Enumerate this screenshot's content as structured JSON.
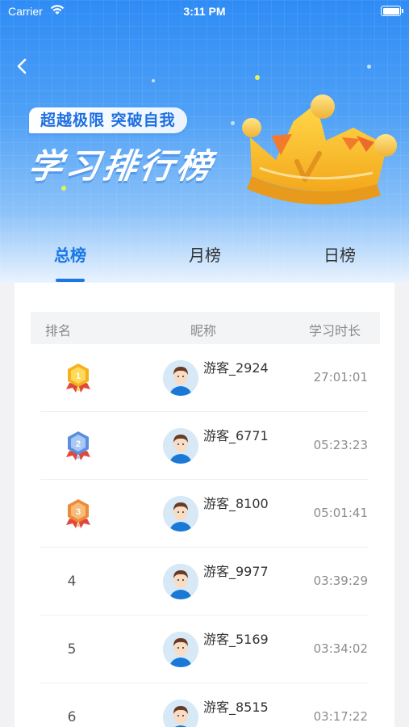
{
  "status_bar": {
    "carrier": "Carrier",
    "time": "3:11 PM"
  },
  "header": {
    "slogan": "超越极限  突破自我",
    "title": "学习排行榜"
  },
  "tabs": [
    {
      "label": "总榜",
      "active": true
    },
    {
      "label": "月榜",
      "active": false
    },
    {
      "label": "日榜",
      "active": false
    }
  ],
  "table": {
    "headers": {
      "rank": "排名",
      "nickname": "昵称",
      "duration": "学习时长"
    },
    "rows": [
      {
        "rank": "1",
        "medal": "gold",
        "nickname": "游客_2924",
        "duration": "27:01:01"
      },
      {
        "rank": "2",
        "medal": "silver",
        "nickname": "游客_6771",
        "duration": "05:23:23"
      },
      {
        "rank": "3",
        "medal": "bronze",
        "nickname": "游客_8100",
        "duration": "05:01:41"
      },
      {
        "rank": "4",
        "medal": "",
        "nickname": "游客_9977",
        "duration": "03:39:29"
      },
      {
        "rank": "5",
        "medal": "",
        "nickname": "游客_5169",
        "duration": "03:34:02"
      },
      {
        "rank": "6",
        "medal": "",
        "nickname": "游客_8515",
        "duration": "03:17:22"
      }
    ]
  },
  "colors": {
    "accent": "#1a78e6",
    "header_blue": "#2f8cf5",
    "gold": "#f6b21c",
    "silver": "#5a8fe0",
    "bronze": "#ee8a3a"
  }
}
